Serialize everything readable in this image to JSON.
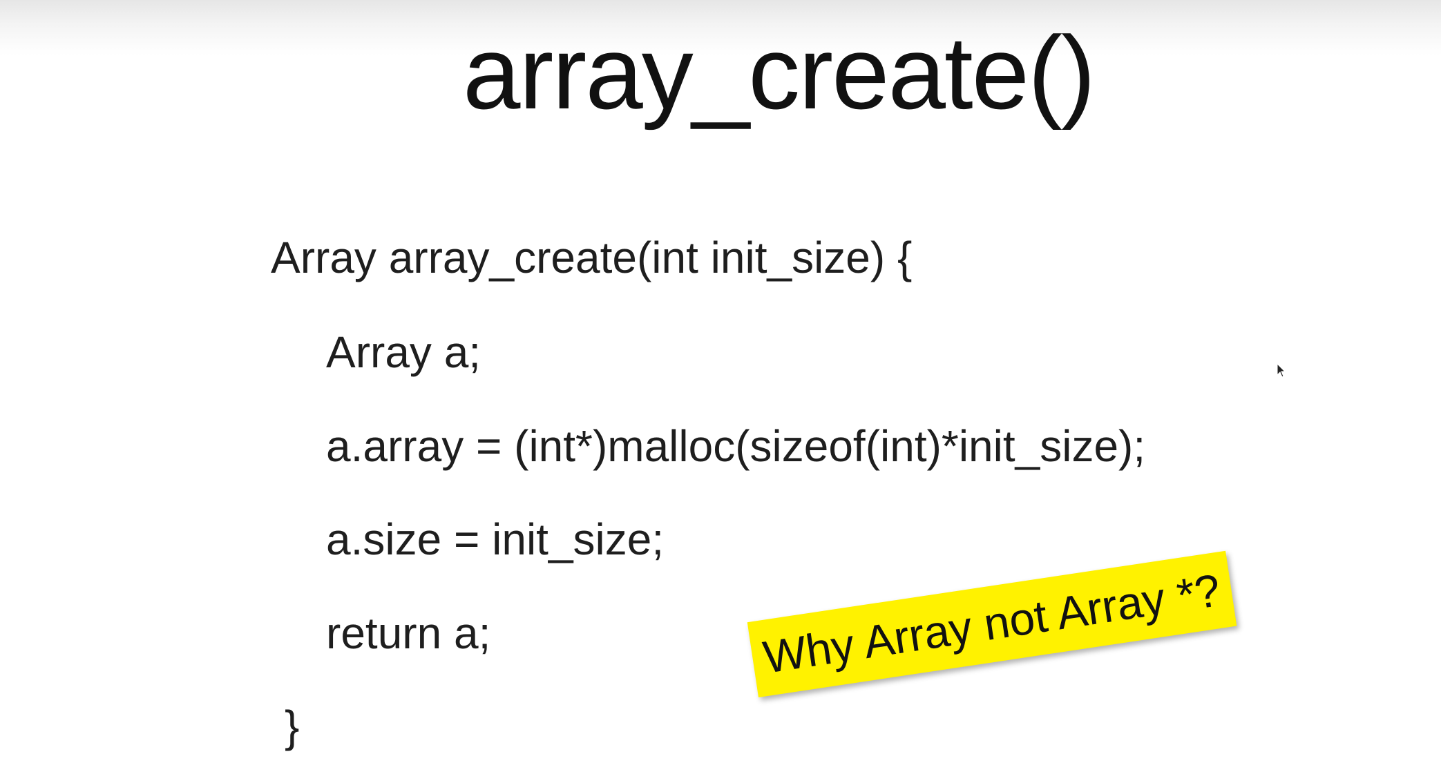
{
  "slide": {
    "title": "array_create()",
    "code_lines": [
      "Array array_create(int init_size) {",
      "Array a;",
      "a.array = (int*)malloc(sizeof(int)*init_size);",
      "a.size = init_size;",
      "return a;",
      "}"
    ],
    "annotation": "Why Array not Array *?",
    "annotation_color": "#fff200"
  },
  "icons": {
    "cursor": "mouse-pointer-icon"
  }
}
